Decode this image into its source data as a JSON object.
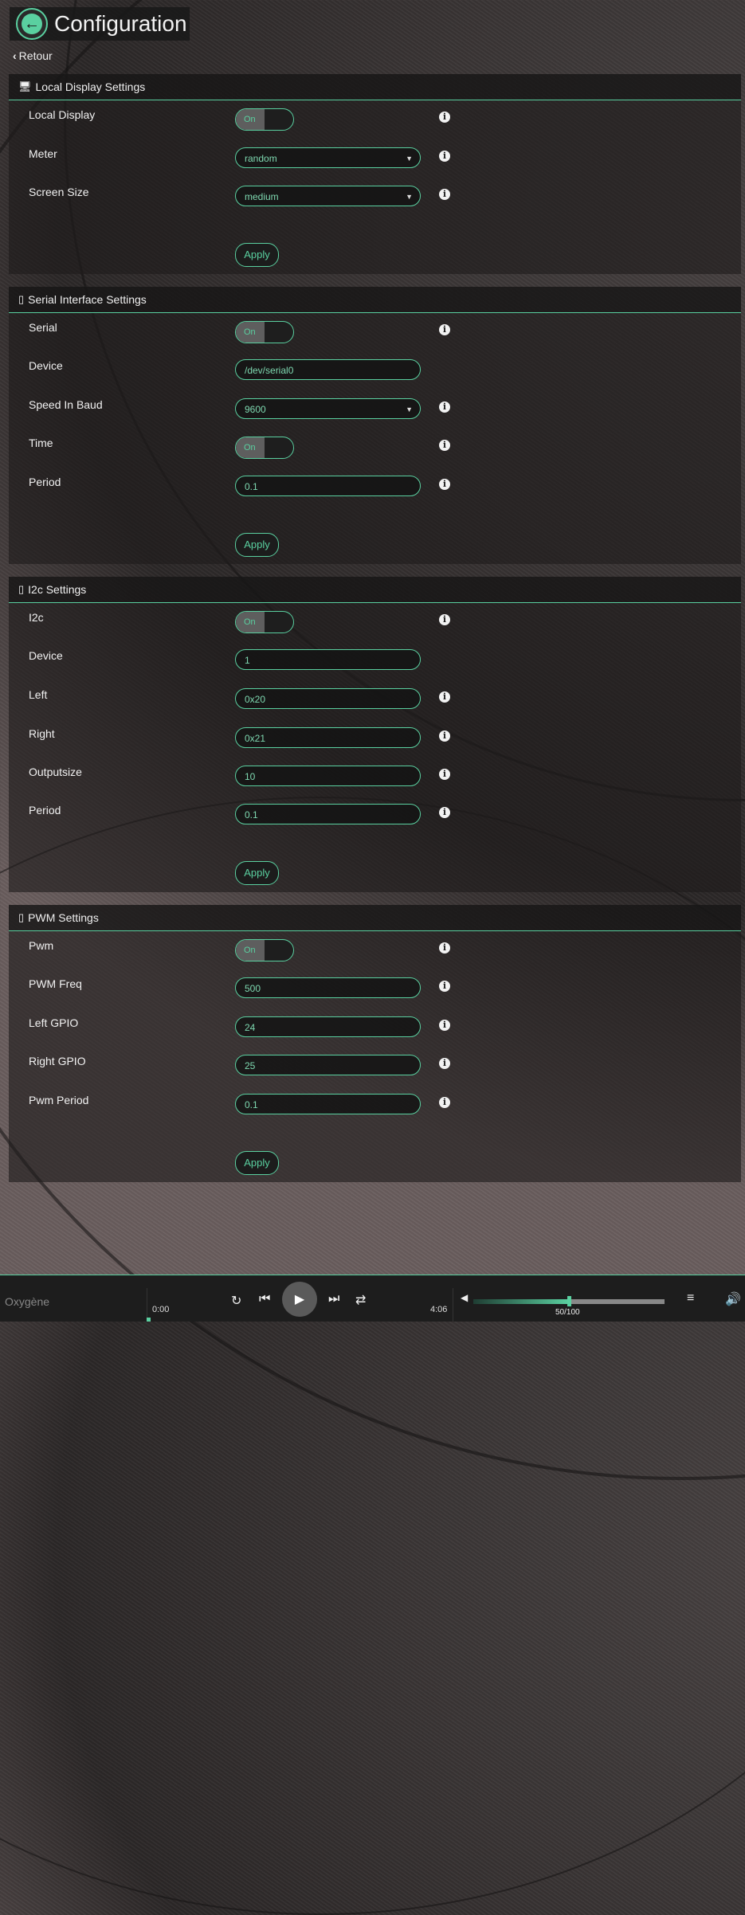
{
  "header": {
    "title": "Configuration",
    "back_icon": "arrow-left-icon"
  },
  "retour_label": "Retour",
  "colors": {
    "accent": "#5ad0a0"
  },
  "sections": [
    {
      "title": "Local Display Settings",
      "icon": "monitor-icon",
      "rows": [
        {
          "label": "Local Display",
          "type": "toggle",
          "value": "On",
          "info": true
        },
        {
          "label": "Meter",
          "type": "select",
          "value": "random",
          "info": true
        },
        {
          "label": "Screen Size",
          "type": "select",
          "value": "medium",
          "info": true
        }
      ],
      "apply_label": "Apply"
    },
    {
      "title": "Serial Interface Settings",
      "icon": "chip-icon",
      "rows": [
        {
          "label": "Serial",
          "type": "toggle",
          "value": "On",
          "info": true
        },
        {
          "label": "Device",
          "type": "input",
          "value": "/dev/serial0",
          "info": false
        },
        {
          "label": "Speed In Baud",
          "type": "select",
          "value": "9600",
          "info": true
        },
        {
          "label": "Time",
          "type": "toggle",
          "value": "On",
          "info": true
        },
        {
          "label": "Period",
          "type": "input",
          "value": "0.1",
          "info": true
        }
      ],
      "apply_label": "Apply"
    },
    {
      "title": "I2c Settings",
      "icon": "chip-icon",
      "rows": [
        {
          "label": "I2c",
          "type": "toggle",
          "value": "On",
          "info": true
        },
        {
          "label": "Device",
          "type": "input",
          "value": "1",
          "info": false
        },
        {
          "label": "Left",
          "type": "input",
          "value": "0x20",
          "info": true
        },
        {
          "label": "Right",
          "type": "input",
          "value": "0x21",
          "info": true
        },
        {
          "label": "Outputsize",
          "type": "input",
          "value": "10",
          "info": true
        },
        {
          "label": "Period",
          "type": "input",
          "value": "0.1",
          "info": true
        }
      ],
      "apply_label": "Apply"
    },
    {
      "title": "PWM Settings",
      "icon": "chip-icon",
      "rows": [
        {
          "label": "Pwm",
          "type": "toggle",
          "value": "On",
          "info": true
        },
        {
          "label": "PWM Freq",
          "type": "input",
          "value": "500",
          "info": true
        },
        {
          "label": "Left GPIO",
          "type": "input",
          "value": "24",
          "info": true
        },
        {
          "label": "Right GPIO",
          "type": "input",
          "value": "25",
          "info": true
        },
        {
          "label": "Pwm Period",
          "type": "input",
          "value": "0.1",
          "info": true
        }
      ],
      "apply_label": "Apply"
    }
  ],
  "player": {
    "track_title": "Oxygène",
    "elapsed": "0:00",
    "duration": "4:06",
    "volume_label": "50/100",
    "volume_fraction": 0.5
  }
}
